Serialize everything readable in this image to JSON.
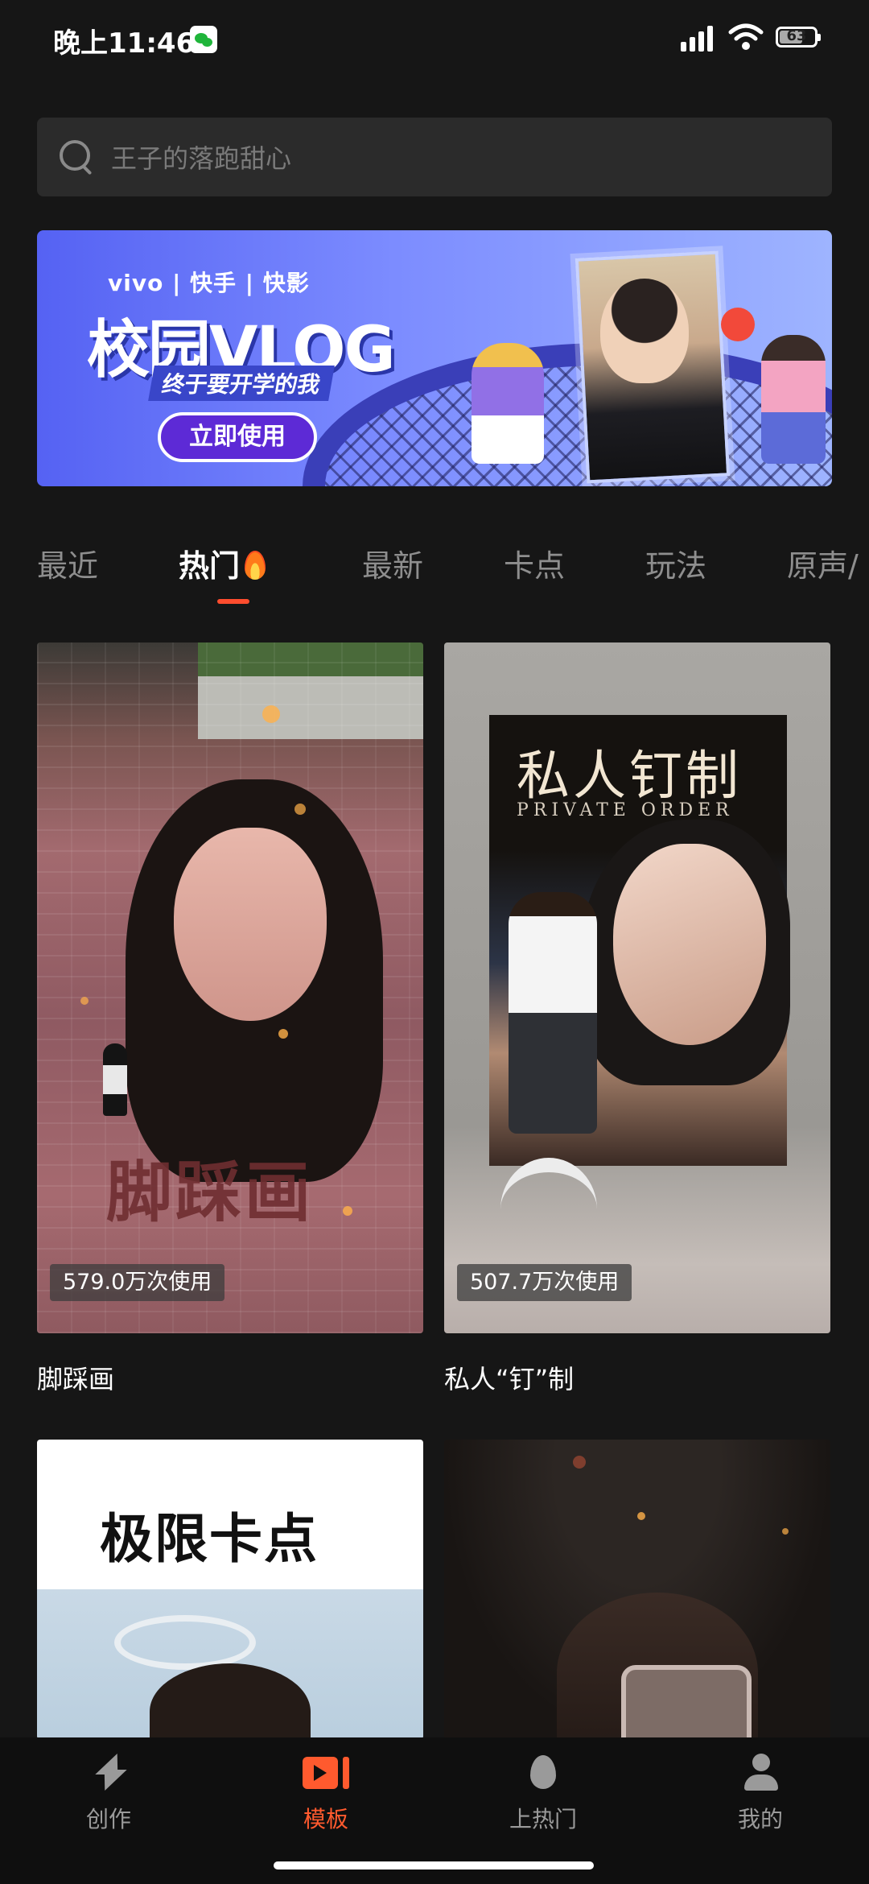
{
  "status_bar": {
    "time": "晚上11:46",
    "battery": "63"
  },
  "search": {
    "placeholder": "王子的落跑甜心"
  },
  "banner": {
    "brands": "vivo | 快手 | 快影",
    "title": "校园VLOG",
    "subtitle": "终于要开学的我",
    "cta": "立即使用"
  },
  "tabs": [
    {
      "label": "最近"
    },
    {
      "label": "热门"
    },
    {
      "label": "最新"
    },
    {
      "label": "卡点"
    },
    {
      "label": "玩法"
    },
    {
      "label": "原声/"
    }
  ],
  "templates": [
    {
      "title": "脚踩画",
      "usage": "579.0万次使用",
      "art_text": "脚踩画"
    },
    {
      "title": "私人“钉”制",
      "usage": "507.7万次使用",
      "art_text": "私人钉制",
      "art_subtext": "PRIVATE ORDER"
    },
    {
      "art_text": "极限卡点"
    },
    {}
  ],
  "bottom_nav": [
    {
      "label": "创作",
      "icon": "lightning-icon"
    },
    {
      "label": "模板",
      "icon": "template-icon",
      "active": true
    },
    {
      "label": "上热门",
      "icon": "flame-icon"
    },
    {
      "label": "我的",
      "icon": "person-icon"
    }
  ],
  "colors": {
    "accent": "#ff5a2e",
    "background": "#161616"
  }
}
